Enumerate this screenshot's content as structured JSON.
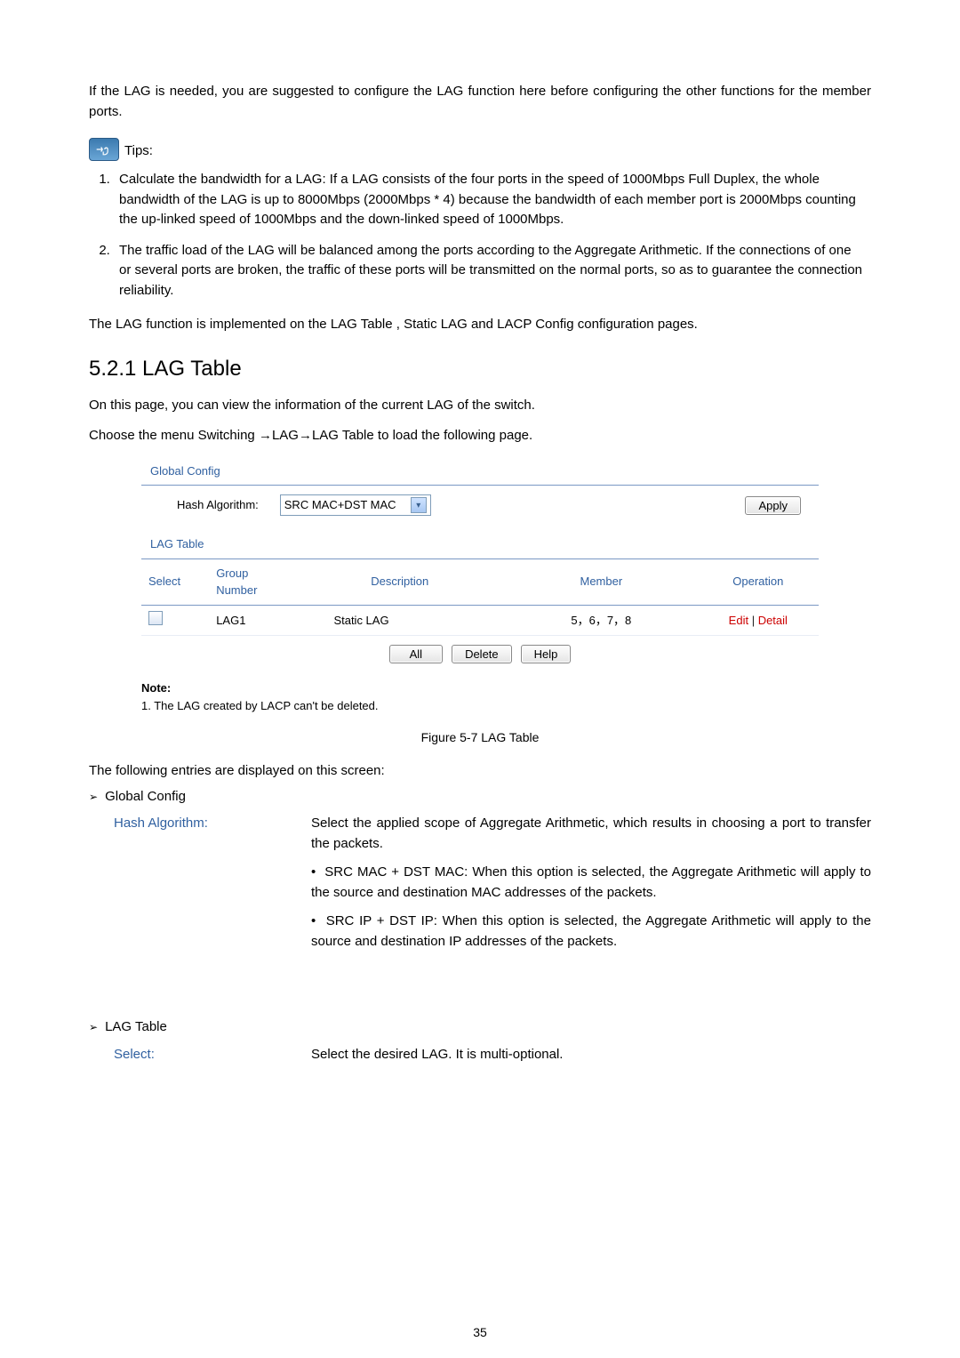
{
  "paragraphs": {
    "intro": "If the LAG is needed, you are suggested to configure the LAG function here before configuring the other functions for the member ports.",
    "tips_label": " Tips:",
    "tip1": "Calculate the bandwidth for a LAG: If a LAG consists of the four ports in the speed of 1000Mbps Full Duplex, the whole bandwidth of the LAG is up to 8000Mbps (2000Mbps * 4) because the bandwidth of each member port is 2000Mbps counting the up-linked speed of 1000Mbps and the down-linked speed of 1000Mbps.",
    "tip2": "The traffic load of the LAG will be balanced among the ports according to the Aggregate Arithmetic. If the connections of one or several ports are broken, the traffic of these ports will be transmitted on the normal ports, so as to guarantee the connection reliability.",
    "lag_impl": "The LAG function is implemented on the LAG Table , Static LAG  and LACP Config  configuration pages.",
    "section_number": "5.2.1  LAG Table",
    "on_this_page": "On this page, you can view the information of the current LAG of the switch.",
    "choose_menu": "Choose the menu Switching  →LAG→LAG Table  to load the following page.",
    "following_entries": "The following entries are displayed on this screen:",
    "global_config_label": "Global Config",
    "lag_table_label": "LAG Table"
  },
  "panel": {
    "global_config": "Global Config",
    "hash_label": "Hash Algorithm:",
    "hash_value": "SRC MAC+DST MAC",
    "apply_btn": "Apply",
    "lag_table_title": "LAG Table",
    "cols": {
      "select": "Select",
      "group": "Group Number",
      "description": "Description",
      "member": "Member",
      "operation": "Operation"
    },
    "row0": {
      "group": "LAG1",
      "description": "Static LAG",
      "member": "5，6，7，8",
      "op_edit": "Edit",
      "op_detail": "Detail"
    },
    "btn_all": "All",
    "btn_delete": "Delete",
    "btn_help": "Help",
    "note_title": "Note:",
    "note_body": "1. The LAG created by LACP can't be deleted.",
    "figure_caption": "Figure 5-7 LAG Table"
  },
  "defs": {
    "hash_term": "Hash Algorithm:",
    "hash_body": "Select the applied scope of Aggregate Arithmetic, which results in choosing a port to transfer the packets.",
    "hash_bullet1": "SRC MAC + DST MAC:  When this option is selected, the Aggregate Arithmetic will apply to the source and destination MAC addresses of the packets.",
    "hash_bullet2": "SRC IP + DST IP: When this option is selected, the Aggregate Arithmetic will apply to the source and destination IP addresses of the packets.",
    "select_term": "Select:",
    "select_body": "Select the desired LAG. It is multi-optional."
  },
  "page_number": "35"
}
